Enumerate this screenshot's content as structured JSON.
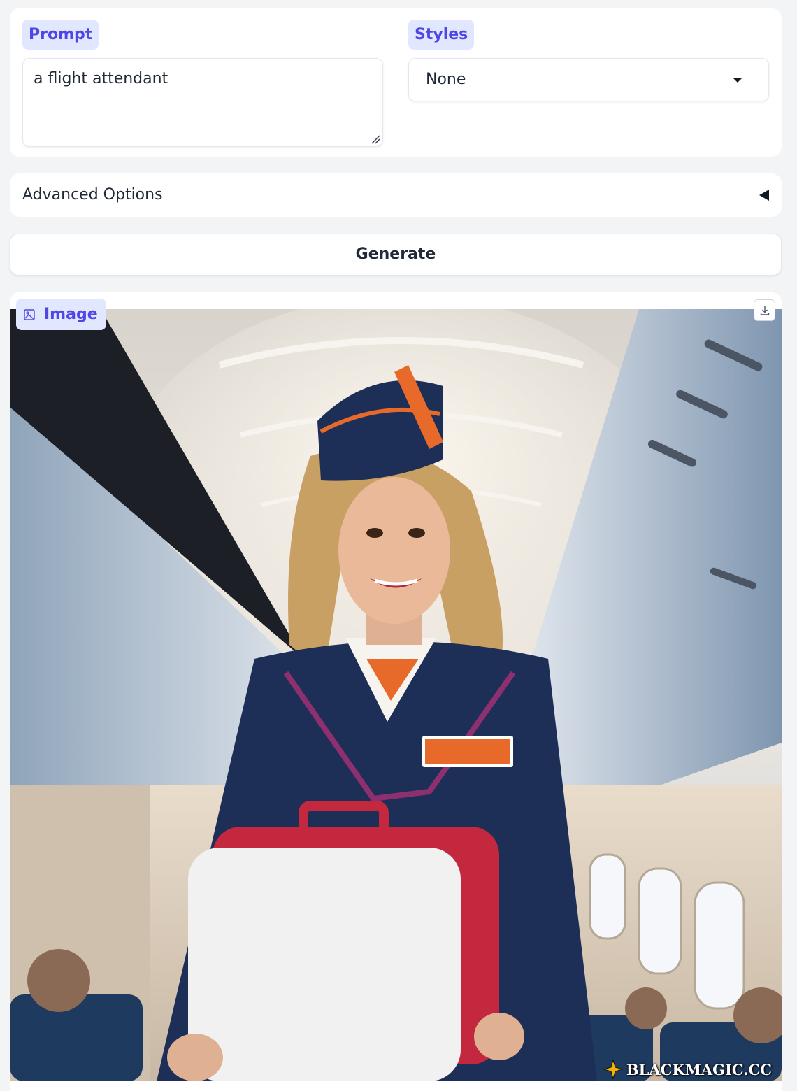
{
  "prompt": {
    "label": "Prompt",
    "value": "a flight attendant"
  },
  "styles": {
    "label": "Styles",
    "selected": "None"
  },
  "advanced_options": {
    "label": "Advanced Options"
  },
  "generate": {
    "label": "Generate"
  },
  "image_output": {
    "label": "Image",
    "watermark": "BLACKMAGIC.CC"
  },
  "colors": {
    "accent": "#4f46e5",
    "chip_bg": "#e0e7ff",
    "page_bg": "#f3f4f6"
  },
  "icons": [
    "image-icon",
    "download-icon",
    "chevron-down-icon",
    "collapse-arrow-icon",
    "resize-handle-icon",
    "sparkle-icon"
  ]
}
